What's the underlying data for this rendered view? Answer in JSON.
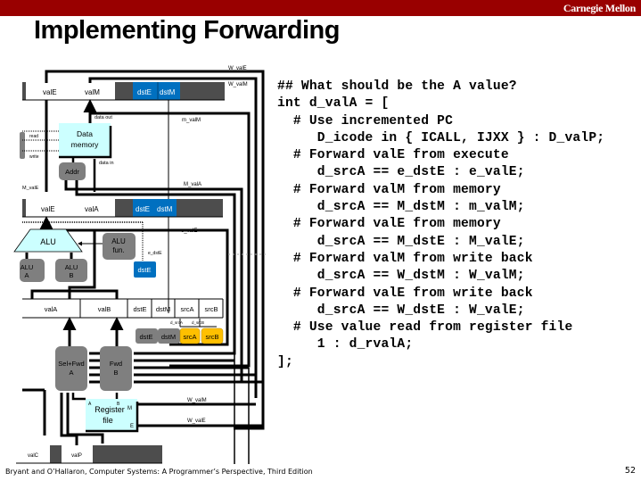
{
  "header": {
    "brand": "Carnegie Mellon",
    "title": "Implementing Forwarding",
    "bar_color": "#990000"
  },
  "diagram": {
    "signals": {
      "W_valE": "W_valE",
      "W_valM": "W_valM",
      "m_valM": "m_valM",
      "M_valA": "M_valA",
      "M_valE": "M_valE",
      "e_valE": "e_valE",
      "e_dstE": "e_dstE",
      "d_srcA": "d_srcA",
      "d_srcB": "d_srcB",
      "W_valM_bottom": "W_valM",
      "W_valE_bottom": "W_valE"
    },
    "memory_stage": {
      "valE": "valE",
      "valM": "valM",
      "dstE": "dstE",
      "dstM": "dstM",
      "data_out": "data out",
      "data_in": "data in",
      "read": "read",
      "write": "write",
      "data_memory": [
        "Data",
        "memory"
      ],
      "addr": "Addr"
    },
    "execute_stage": {
      "valE": "valE",
      "valA": "valA",
      "dstE": "dstE",
      "dstM": "dstM",
      "alu": "ALU",
      "alu_fun": [
        "ALU",
        "fun."
      ],
      "alu_a": [
        "ALU",
        "A"
      ],
      "alu_b": [
        "ALU",
        "B"
      ],
      "dstE_block": "dstE"
    },
    "decode_stage": {
      "fields": [
        "valA",
        "valB",
        "dstE",
        "dstM",
        "srcA",
        "srcB"
      ],
      "reg_ids": [
        "dstE",
        "dstM",
        "srcA",
        "srcB"
      ],
      "sel_fwd_a": [
        "Sel+Fwd",
        "A"
      ],
      "fwd_b": [
        "Fwd",
        "B"
      ],
      "register_file": [
        "Register",
        "file"
      ],
      "port_a": "A",
      "port_b": "B",
      "port_m": "M",
      "port_e": "E"
    },
    "fetch_stage": {
      "valC": "valC",
      "valP": "valP"
    },
    "colors": {
      "blue": "#0070C0",
      "cyan": "#CCFFFF",
      "gray": "#7F7F7F",
      "dark": "#4D4D4D",
      "orange": "#FFC000"
    }
  },
  "code": {
    "lines": [
      "## What should be the A value?",
      "int d_valA = [",
      "  # Use incremented PC",
      "     D_icode in { ICALL, IJXX } : D_valP;",
      "  # Forward valE from execute",
      "     d_srcA == e_dstE : e_valE;",
      "  # Forward valM from memory",
      "     d_srcA == M_dstM : m_valM;",
      "  # Forward valE from memory",
      "     d_srcA == M_dstE : M_valE;",
      "  # Forward valM from write back",
      "     d_srcA == W_dstM : W_valM;",
      "  # Forward valE from write back",
      "     d_srcA == W_dstE : W_valE;",
      "  # Use value read from register file",
      "     1 : d_rvalA;",
      "];"
    ]
  },
  "footer": {
    "citation": "Bryant and O’Hallaron, Computer Systems: A Programmer’s Perspective, Third Edition",
    "page_number": "52"
  }
}
